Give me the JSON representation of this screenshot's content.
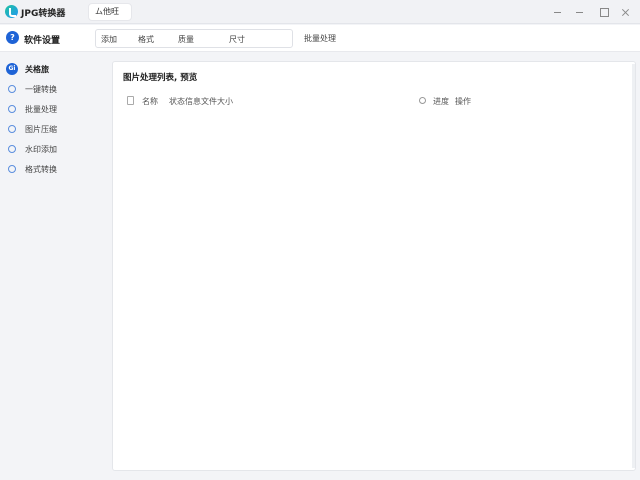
{
  "app": {
    "title": "JPG转换器",
    "tab_label": "ム他旺"
  },
  "toolbar": {
    "brand_label": "软件设置",
    "brand_icon_glyph": "?",
    "filters": [
      "添加",
      "格式",
      "质量",
      "尺寸"
    ],
    "action_label": "批量处理"
  },
  "sidebar": {
    "items": [
      {
        "label": "关格旅",
        "icon": "home-icon",
        "active": true,
        "glyph": "Gi"
      },
      {
        "label": "一键转换",
        "icon": "convert-icon",
        "active": false
      },
      {
        "label": "批量处理",
        "icon": "batch-icon",
        "active": false
      },
      {
        "label": "图片压缩",
        "icon": "compress-icon",
        "active": false
      },
      {
        "label": "水印添加",
        "icon": "watermark-icon",
        "active": false
      },
      {
        "label": "格式转换",
        "icon": "format-icon",
        "active": false
      }
    ]
  },
  "main": {
    "heading": "图片处理列表, 预览",
    "columns_left": [
      "名称",
      "状态信息",
      "文件大小"
    ],
    "columns_right": [
      "进度",
      "操作"
    ]
  },
  "colors": {
    "accent": "#1e63d6",
    "brand_gradient_start": "#1fc3a0",
    "brand_gradient_end": "#2196f3"
  }
}
